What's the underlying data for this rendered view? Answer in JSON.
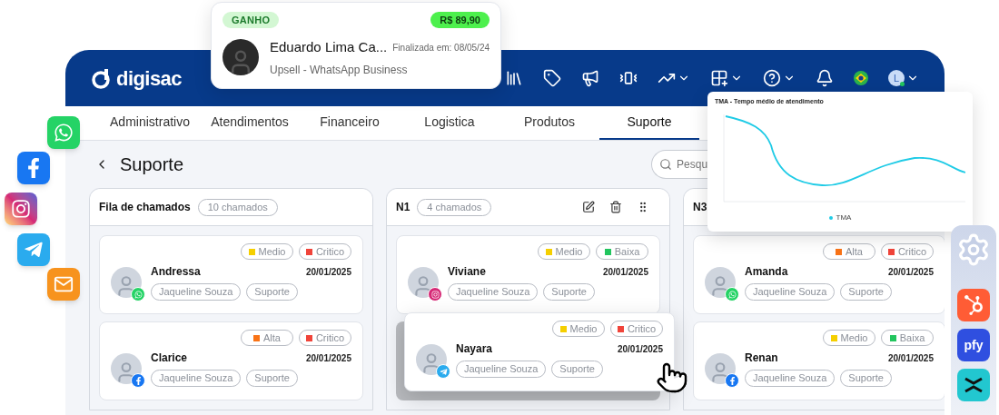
{
  "deal_card": {
    "status": "GANHO",
    "value": "R$ 89,90",
    "name": "Eduardo Lima Ca...",
    "finished": "Finalizada em: 08/05/24",
    "subtitle": "Upsell - WhatsApp Business"
  },
  "social_icons": [
    {
      "kind": "whatsapp"
    },
    {
      "kind": "facebook"
    },
    {
      "kind": "instagram"
    },
    {
      "kind": "telegram"
    },
    {
      "kind": "email"
    }
  ],
  "header": {
    "logo": "digisac",
    "user_initial": "L"
  },
  "tabs": [
    {
      "label": "Administrativo",
      "selected": false
    },
    {
      "label": "Atendimentos",
      "selected": false
    },
    {
      "label": "Financeiro",
      "selected": false
    },
    {
      "label": "Logistica",
      "selected": false
    },
    {
      "label": "Produtos",
      "selected": false
    },
    {
      "label": "Suporte",
      "selected": true
    }
  ],
  "page_title": "Suporte",
  "search": {
    "placeholder": "Pesqu"
  },
  "columns": [
    {
      "title": "Fila de chamados",
      "count": "10 chamados",
      "actions": false,
      "cards": [
        {
          "name": "Andressa",
          "date": "20/01/2025",
          "channel_badge": {
            "kind": "whatsapp"
          },
          "dragging": false,
          "tags": [
            {
              "label": "Medio",
              "color": "#f5cf00"
            },
            {
              "label": "Critico",
              "color": "#f0443a"
            }
          ],
          "pills": [
            "Jaqueline Souza",
            "Suporte"
          ]
        },
        {
          "name": "Clarice",
          "date": "20/01/2025",
          "channel_badge": {
            "kind": "facebook"
          },
          "dragging": false,
          "tags": [
            {
              "label": "Alta",
              "color": "#f97316"
            },
            {
              "label": "Critico",
              "color": "#f0443a"
            }
          ],
          "pills": [
            "Jaqueline Souza",
            "Suporte"
          ]
        }
      ]
    },
    {
      "title": "N1",
      "count": "4 chamados",
      "actions": true,
      "cards": [
        {
          "name": "Viviane",
          "date": "20/01/2025",
          "channel_badge": {
            "kind": "instagram"
          },
          "dragging": false,
          "tags": [
            {
              "label": "Medio",
              "color": "#f5cf00"
            },
            {
              "label": "Baixa",
              "color": "#22c55e"
            }
          ],
          "pills": [
            "Jaqueline Souza",
            "Suporte"
          ]
        },
        {
          "name": "Nayara",
          "date": "20/01/2025",
          "channel_badge": {
            "kind": "telegram"
          },
          "dragging": true,
          "tags": [
            {
              "label": "Medio",
              "color": "#f5cf00"
            },
            {
              "label": "Critico",
              "color": "#f0443a"
            }
          ],
          "pills": [
            "Jaqueline Souza",
            "Suporte"
          ]
        }
      ]
    },
    {
      "title": "N3",
      "actions": false,
      "cards": [
        {
          "name": "Amanda",
          "date": "20/01/2025",
          "channel_badge": {
            "kind": "whatsapp"
          },
          "dragging": false,
          "tags": [
            {
              "label": "Alta",
              "color": "#f97316"
            },
            {
              "label": "Critico",
              "color": "#f0443a"
            }
          ],
          "pills": [
            "Jaqueline Souza",
            "Suporte"
          ]
        },
        {
          "name": "Renan",
          "date": "20/01/2025",
          "channel_badge": {
            "kind": "facebook"
          },
          "dragging": false,
          "tags": [
            {
              "label": "Medio",
              "color": "#f5cf00"
            },
            {
              "label": "Baixa",
              "color": "#22c55e"
            }
          ],
          "pills": [
            "Jaqueline Souza",
            "Suporte"
          ]
        }
      ]
    }
  ],
  "chart_card": {
    "title": "TMA - Tempo médio de atendimento",
    "legend": "TMA"
  },
  "integrations": [
    {
      "kind": "gear"
    },
    {
      "kind": "hubspot"
    },
    {
      "kind": "text",
      "label": "pfy"
    },
    {
      "kind": "chevrons"
    }
  ]
}
